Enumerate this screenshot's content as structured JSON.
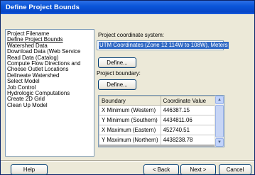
{
  "window": {
    "title": "Define Project Bounds"
  },
  "steps": [
    "Project Filename",
    "Define Project Bounds",
    "Watershed Data",
    "Download Data (Web Service",
    "Read Data (Catalog)",
    "Compute Flow Directions and",
    "Choose Outlet Locations",
    "Delineate Watershed",
    "Select Model",
    "Job Control",
    "Hydrologic Computations",
    "Create 2D Grid",
    "Clean Up Model"
  ],
  "selected_step": "Define Project Bounds",
  "coordinate_system": {
    "label": "Project coordinate system:",
    "value": "UTM Coordinates (Zone 12 114W to 108W), Meters",
    "define_button": "Define..."
  },
  "boundary": {
    "label": "Project boundary:",
    "define_button": "Define...",
    "columns": [
      "Boundary",
      "Coordinate Value"
    ],
    "rows": [
      {
        "name": "X Minimum (Western)",
        "value": "446387.15"
      },
      {
        "name": "Y Minimum (Southern)",
        "value": "4434811.06"
      },
      {
        "name": "X Maximum (Eastern)",
        "value": "452740.51"
      },
      {
        "name": "Y Maximum (Northern)",
        "value": "4438238.78"
      }
    ]
  },
  "footer": {
    "help": "Help",
    "back": "< Back",
    "next": "Next >",
    "cancel": "Cancel"
  },
  "colors": {
    "title_bar": "#0a55d9",
    "selection": "#316ac5",
    "dialog_bg": "#ece9d8"
  }
}
